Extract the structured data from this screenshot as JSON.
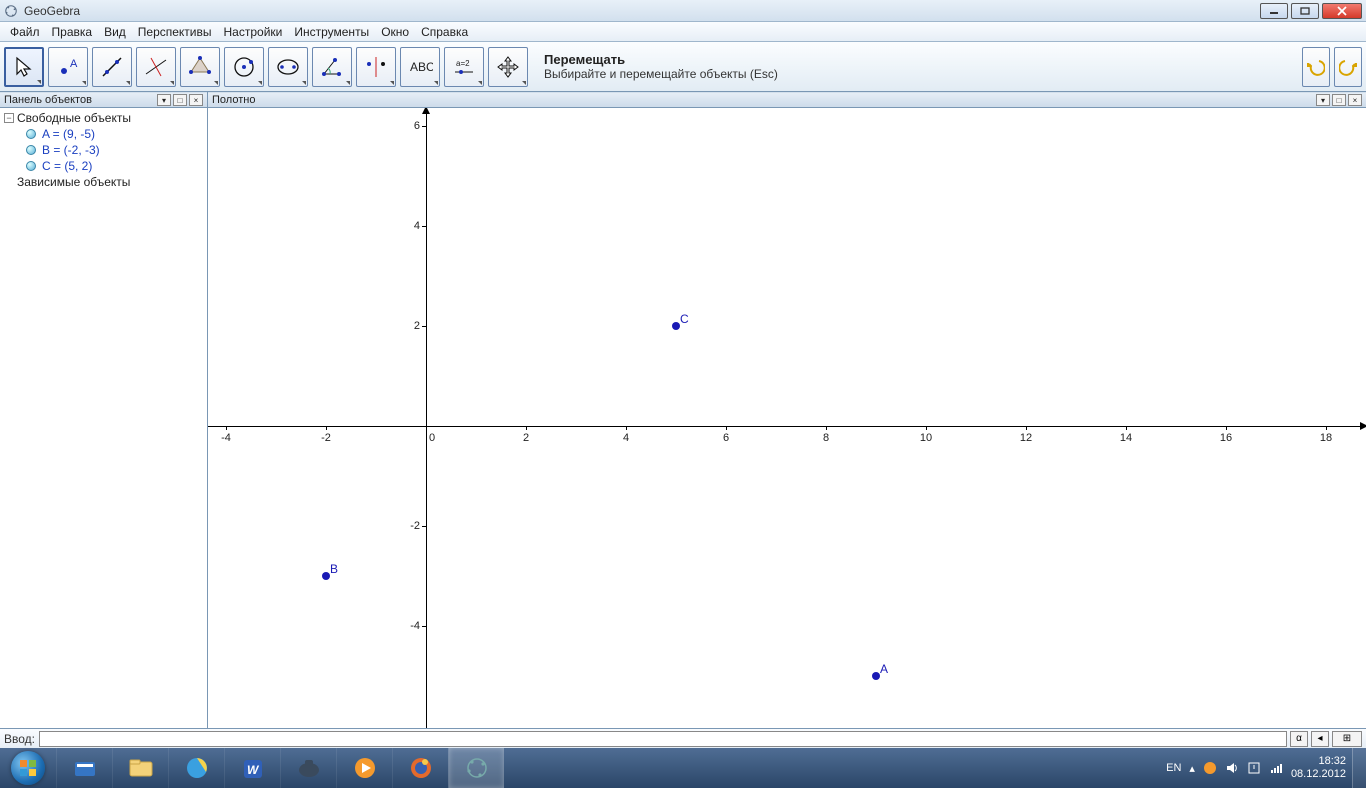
{
  "title": "GeoGebra",
  "menu": {
    "file": "Файл",
    "edit": "Правка",
    "view": "Вид",
    "perspectives": "Перспективы",
    "settings": "Настройки",
    "tools": "Инструменты",
    "window": "Окно",
    "help": "Справка"
  },
  "toolbar_hint": {
    "title": "Перемещать",
    "desc": "Выбирайте и перемещайте объекты (Esc)"
  },
  "left_panel": {
    "title": "Панель объектов",
    "free": "Свободные объекты",
    "dep": "Зависимые объекты",
    "objects": [
      {
        "label": "A = (9, -5)"
      },
      {
        "label": "B = (-2, -3)"
      },
      {
        "label": "C = (5, 2)"
      }
    ]
  },
  "right_panel": {
    "title": "Полотно"
  },
  "input": {
    "label": "Ввод:"
  },
  "taskbar": {
    "lang": "EN",
    "time": "18:32",
    "date": "08.12.2012"
  },
  "x_ticks": [
    "-4",
    "-2",
    "0",
    "2",
    "4",
    "6",
    "8",
    "10",
    "12",
    "14",
    "16",
    "18"
  ],
  "y_ticks": [
    "6",
    "4",
    "2",
    "-2",
    "-4"
  ],
  "points": {
    "A": {
      "x": 9,
      "y": -5
    },
    "B": {
      "x": -2,
      "y": -3
    },
    "C": {
      "x": 5,
      "y": 2
    }
  }
}
